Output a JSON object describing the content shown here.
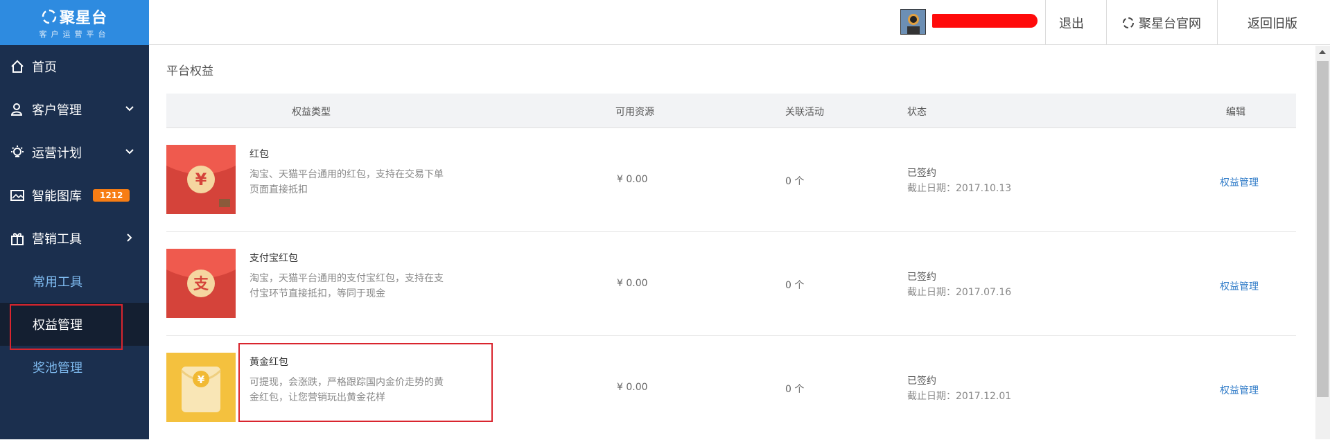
{
  "brand": {
    "name": "聚星台",
    "subtitle": "客户运营平台",
    "color": "#2e8be0"
  },
  "sidebar": {
    "items": [
      {
        "label": "首页",
        "icon": "home-icon"
      },
      {
        "label": "客户管理",
        "icon": "users-icon",
        "chevron": "down"
      },
      {
        "label": "运营计划",
        "icon": "bulb-icon",
        "chevron": "down"
      },
      {
        "label": "智能图库",
        "icon": "image-icon",
        "badge": "1212"
      },
      {
        "label": "营销工具",
        "icon": "gift-icon",
        "chevron": "right"
      }
    ],
    "subitems": [
      {
        "label": "常用工具"
      },
      {
        "label": "权益管理",
        "active": true
      },
      {
        "label": "奖池管理"
      }
    ]
  },
  "topbar": {
    "logout": "退出",
    "official_site": "聚星台官网",
    "back_old": "返回旧版"
  },
  "page": {
    "title": "平台权益"
  },
  "table": {
    "headers": {
      "type": "权益类型",
      "resource": "可用资源",
      "activity": "关联活动",
      "status": "状态",
      "edit": "编辑"
    },
    "rows": [
      {
        "name": "红包",
        "desc": "淘宝、天猫平台通用的红包，支持在交易下单页面直接抵扣",
        "resource": "¥ 0.00",
        "activity": "0 个",
        "status": "已签约",
        "deadline": "截止日期：2017.10.13",
        "edit": "权益管理",
        "icon_glyph": "¥",
        "icon": "red-packet-icon"
      },
      {
        "name": "支付宝红包",
        "desc": "淘宝，天猫平台通用的支付宝红包，支持在支付宝环节直接抵扣，等同于现金",
        "resource": "¥ 0.00",
        "activity": "0 个",
        "status": "已签约",
        "deadline": "截止日期：2017.07.16",
        "edit": "权益管理",
        "icon_glyph": "支",
        "icon": "alipay-red-packet-icon"
      },
      {
        "name": "黄金红包",
        "desc": "可提现，会涨跌，严格跟踪国内金价走势的黄金红包，让您营销玩出黄金花样",
        "resource": "¥ 0.00",
        "activity": "0 个",
        "status": "已签约",
        "deadline": "截止日期：2017.12.01",
        "edit": "权益管理",
        "icon_glyph": "¥",
        "icon": "gold-packet-icon"
      }
    ]
  },
  "colors": {
    "sidebar_bg": "#1b2f4e",
    "highlight": "#d9252e",
    "link": "#2f7bc8",
    "badge": "#f77d14"
  }
}
